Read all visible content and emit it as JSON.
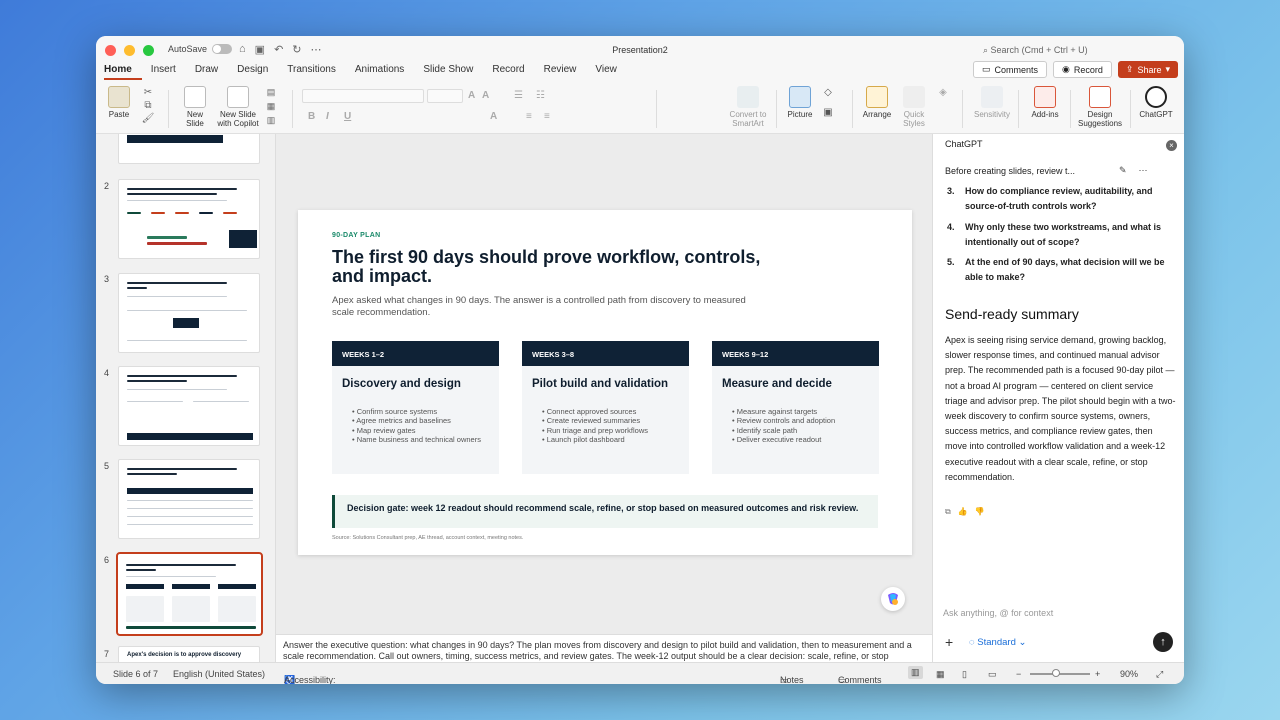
{
  "window": {
    "title": "Presentation2",
    "autosave_label": "AutoSave",
    "search_placeholder": "Search (Cmd + Ctrl + U)"
  },
  "tabs": [
    {
      "label": "Home",
      "active": true
    },
    {
      "label": "Insert"
    },
    {
      "label": "Draw"
    },
    {
      "label": "Design"
    },
    {
      "label": "Transitions"
    },
    {
      "label": "Animations"
    },
    {
      "label": "Slide Show"
    },
    {
      "label": "Record"
    },
    {
      "label": "Review"
    },
    {
      "label": "View"
    }
  ],
  "actions": {
    "comments": "Comments",
    "record": "Record",
    "share": "Share"
  },
  "ribbon": {
    "paste": "Paste",
    "new_slide": "New Slide",
    "new_slide_copilot": "New Slide with Copilot",
    "convert_smartart": "Convert to SmartArt",
    "picture": "Picture",
    "arrange": "Arrange",
    "quick_styles": "Quick Styles",
    "sensitivity": "Sensitivity",
    "addins": "Add-ins",
    "design_suggestions": "Design Suggestions",
    "chatgpt": "ChatGPT"
  },
  "thumbnails": [
    {
      "number": "2",
      "title": "Service demand is up, but response speed and resolution quality are moving the wrong way."
    },
    {
      "number": "3",
      "title": "The issue is scattered context, not lack of team effort."
    },
    {
      "number": "4",
      "title": "Two workstreams give Apex measurable impact without over-scoping."
    },
    {
      "number": "5",
      "title": "The pilot should be judged on operating metrics, not generic productivity."
    },
    {
      "number": "6",
      "title": "The first 90 days should prove workflow, controls, and impact."
    },
    {
      "number": "7",
      "title": "Apex's decision is to approve discovery"
    }
  ],
  "slide": {
    "eyebrow": "90-DAY PLAN",
    "title": "The first 90 days should prove workflow, controls, and impact.",
    "subtitle": "Apex asked what changes in 90 days. The answer is a controlled path from discovery to measured scale recommendation.",
    "columns": [
      {
        "weeks": "WEEKS 1–2",
        "title": "Discovery and design",
        "bullets": [
          "Confirm source systems",
          "Agree metrics and baselines",
          "Map review gates",
          "Name business and technical owners"
        ]
      },
      {
        "weeks": "WEEKS 3–8",
        "title": "Pilot build and validation",
        "bullets": [
          "Connect approved sources",
          "Create reviewed summaries",
          "Run triage and prep workflows",
          "Launch pilot dashboard"
        ]
      },
      {
        "weeks": "WEEKS 9–12",
        "title": "Measure and decide",
        "bullets": [
          "Measure against targets",
          "Review controls and adoption",
          "Identify scale path",
          "Deliver executive readout"
        ]
      }
    ],
    "decision_gate": "Decision gate: week 12 readout should recommend scale, refine, or stop based on measured outcomes and risk review.",
    "source": "Source: Solutions Consultant prep, AE thread, account context, meeting notes."
  },
  "notes": "Answer the executive question: what changes in 90 days? The plan moves from discovery and design to pilot build and validation, then to measurement and a scale recommendation. Call out owners, timing, success metrics, and review gates. The week-12 output should be a clear decision: scale, refine, or stop",
  "chatgpt": {
    "title": "ChatGPT",
    "conversation": "Before creating slides, review t...",
    "questions": [
      {
        "num": "3.",
        "text": "How do compliance review, auditability, and source-of-truth controls work?"
      },
      {
        "num": "4.",
        "text": "Why only these two workstreams, and what is intentionally out of scope?"
      },
      {
        "num": "5.",
        "text": "At the end of 90 days, what decision will we be able to make?"
      }
    ],
    "summary_heading": "Send-ready summary",
    "summary": "Apex is seeing rising service demand, growing backlog, slower response times, and continued manual advisor prep. The recommended path is a focused 90-day pilot — not a broad AI program — centered on client service triage and advisor prep. The pilot should begin with a two-week discovery to confirm source systems, owners, success metrics, and compliance review gates, then move into controlled workflow validation and a week-12 executive readout with a clear scale, refine, or stop recommendation.",
    "input_placeholder": "Ask anything, @ for context",
    "mode": "Standard"
  },
  "status": {
    "slide": "Slide 6 of 7",
    "language": "English (United States)",
    "accessibility": "Accessibility: Investigate",
    "notes": "Notes",
    "comments": "Comments",
    "zoom": "90%"
  },
  "colors": {
    "accent": "#c43e1c",
    "navy": "#0f2236",
    "teal": "#1a8a6a"
  }
}
